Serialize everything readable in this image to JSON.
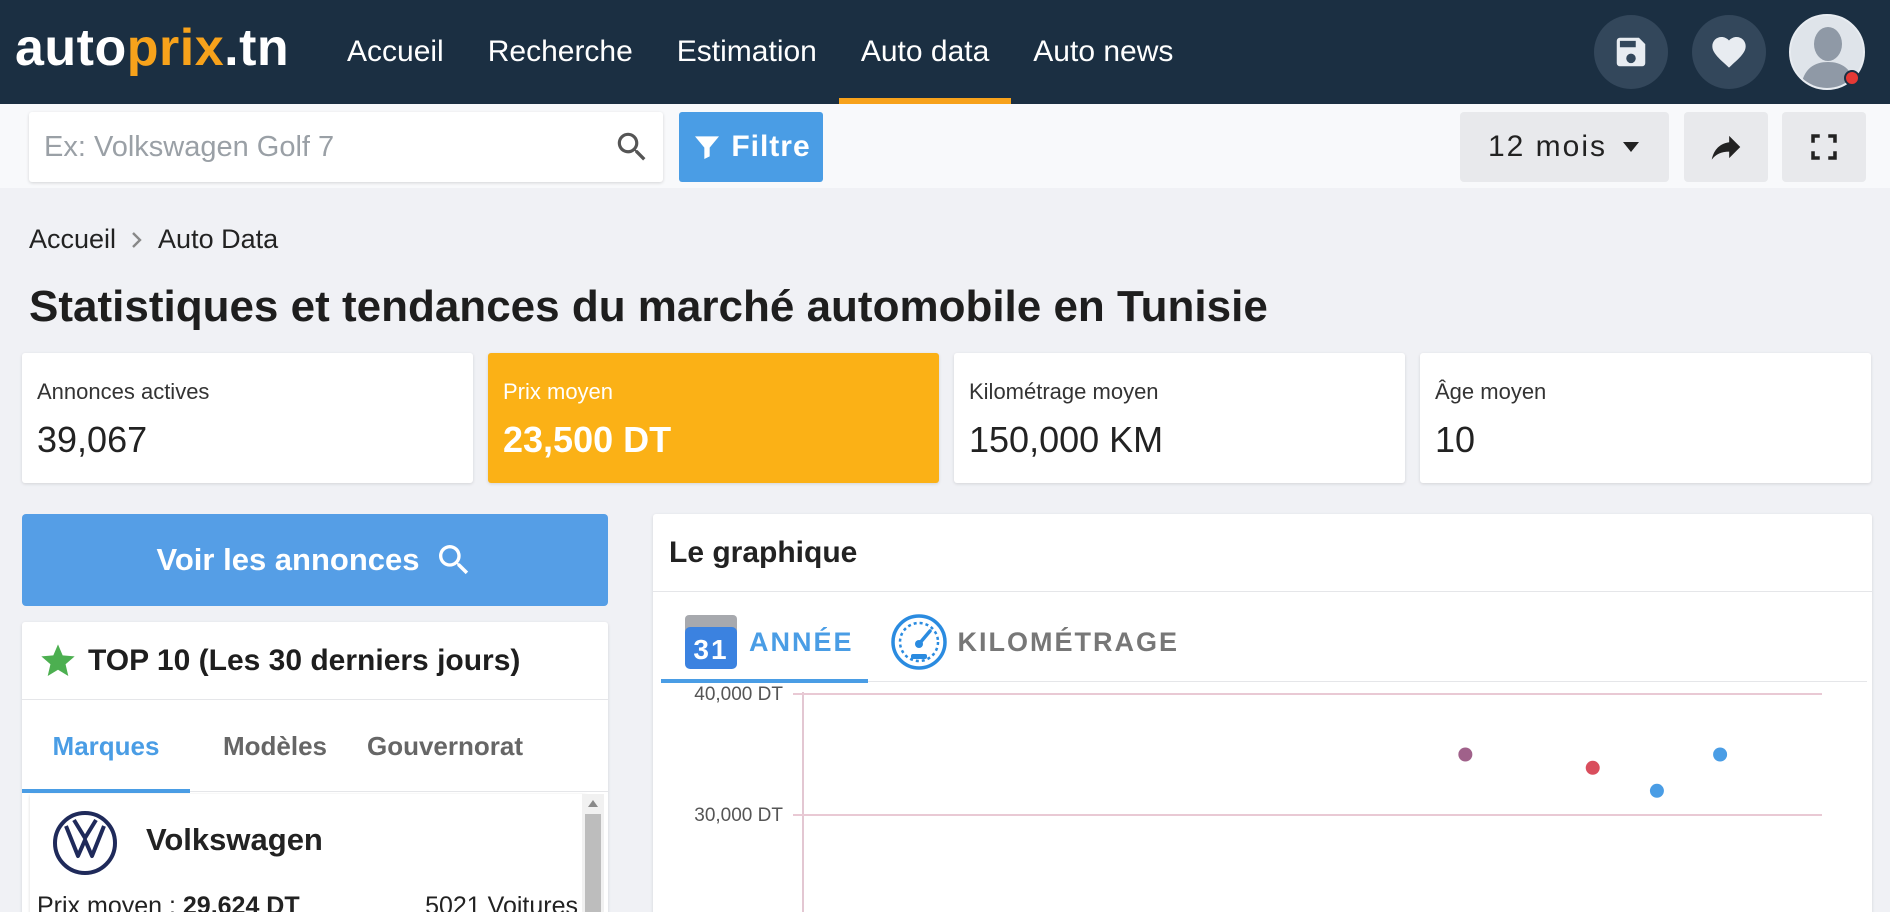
{
  "logo": {
    "part1": "auto",
    "part2": "prix",
    "part3": ".tn"
  },
  "nav": {
    "links": [
      "Accueil",
      "Recherche",
      "Estimation",
      "Auto data",
      "Auto news"
    ],
    "active": "Auto data",
    "icons": [
      "save-icon",
      "heart-icon"
    ]
  },
  "toolbar": {
    "search_placeholder": "Ex: Volkswagen Golf 7",
    "search_value": "",
    "filter_label": "Filtre",
    "period_label": "12 mois"
  },
  "breadcrumb": [
    "Accueil",
    "Auto Data"
  ],
  "page_title": "Statistiques et tendances du marché automobile en Tunisie",
  "stats": [
    {
      "label": "Annonces actives",
      "value": "39,067"
    },
    {
      "label": "Prix moyen",
      "value": "23,500 DT"
    },
    {
      "label": "Kilométrage moyen",
      "value": "150,000 KM"
    },
    {
      "label": "Âge moyen",
      "value": "10"
    }
  ],
  "voir_button": "Voir les annonces",
  "top10": {
    "title": "TOP 10 (Les 30 derniers jours)",
    "tabs": [
      "Marques",
      "Modèles",
      "Gouvernorat"
    ],
    "active_tab": "Marques",
    "items": [
      {
        "name": "Volkswagen",
        "price_label": "Prix moyen :",
        "price": "29,624 DT",
        "count": "5021 Voitures"
      }
    ]
  },
  "chart_panel": {
    "title": "Le graphique",
    "tabs": [
      {
        "label": "ANNÉE",
        "icon": "calendar-icon",
        "calendar_day": "31"
      },
      {
        "label": "KILOMÉTRAGE",
        "icon": "speedometer-icon"
      }
    ],
    "active_tab": "ANNÉE"
  },
  "chart_data": {
    "type": "scatter",
    "title": "",
    "xlabel": "",
    "ylabel": "",
    "yticks": [
      "40,000 DT",
      "30,000 DT"
    ],
    "ytick_values": [
      40000,
      30000
    ],
    "ylim_visible": [
      27000,
      40600
    ],
    "xlim": [
      0,
      100
    ],
    "points": [
      {
        "x": 65.0,
        "y": 35000,
        "color": "#a0618a"
      },
      {
        "x": 77.5,
        "y": 33900,
        "color": "#d94e5d"
      },
      {
        "x": 83.8,
        "y": 32000,
        "color": "#4a9de5"
      },
      {
        "x": 90.0,
        "y": 35000,
        "color": "#4a9de5"
      }
    ],
    "grid": true,
    "grid_color": "#e9c9d4"
  },
  "colors": {
    "nav_bg": "#1b2f42",
    "accent": "#f7a21b",
    "primary_blue": "#4a9de5",
    "highlight_card": "#fbb116"
  }
}
